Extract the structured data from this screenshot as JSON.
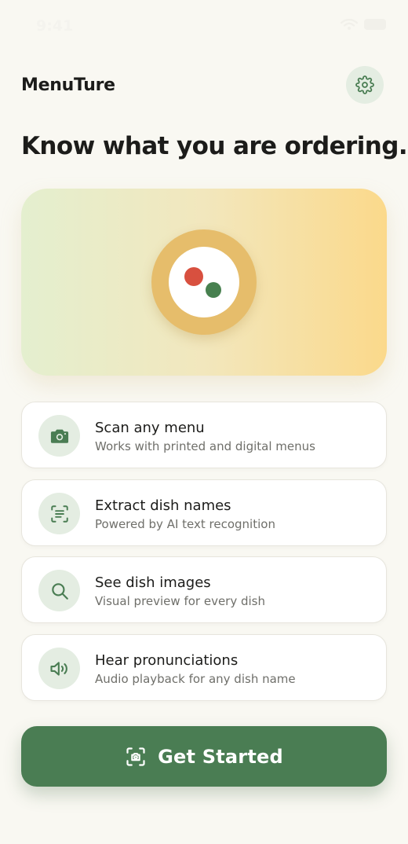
{
  "status": {
    "time": "9:41"
  },
  "header": {
    "title": "MenuTure",
    "settings_icon": "gear-icon"
  },
  "headline": "Know what you are ordering.",
  "hero": {
    "plate_colors": {
      "rim": "#e6bd6b",
      "red": "#d8503f",
      "green": "#47804f"
    }
  },
  "features": [
    {
      "icon": "camera-icon",
      "title": "Scan any menu",
      "subtitle": "Works with printed and digital menus"
    },
    {
      "icon": "text-scan-icon",
      "title": "Extract dish names",
      "subtitle": "Powered by AI text recognition"
    },
    {
      "icon": "search-icon",
      "title": "See dish images",
      "subtitle": "Visual preview for every dish"
    },
    {
      "icon": "speaker-icon",
      "title": "Hear pronunciations",
      "subtitle": "Audio playback for any dish name"
    }
  ],
  "cta": {
    "label": "Get Started",
    "icon": "camera-scan-icon"
  },
  "colors": {
    "accent": "#4a7d53",
    "background": "#f9f8f2",
    "icon_bg": "#e4ede2"
  }
}
